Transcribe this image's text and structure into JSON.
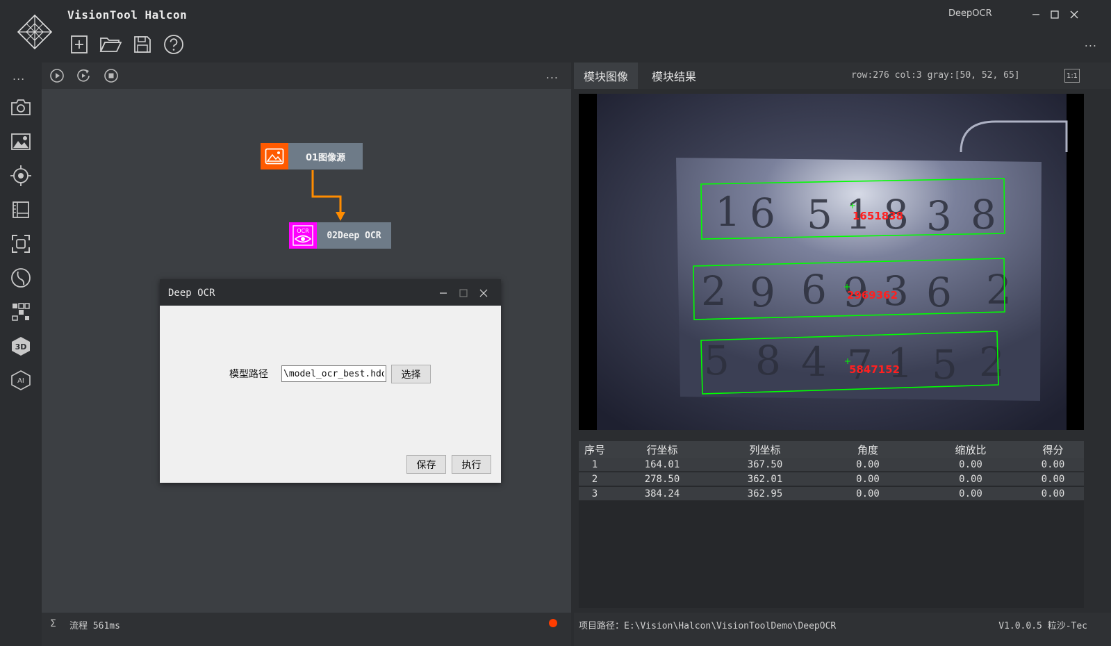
{
  "app": {
    "title": "VisionTool Halcon",
    "window_title": "DeepOCR",
    "more": "..."
  },
  "toolbar": {
    "icons": [
      "new-file-icon",
      "open-folder-icon",
      "save-icon",
      "help-icon"
    ]
  },
  "sidebar": {
    "more": "...",
    "icons": [
      "camera-icon",
      "image-adjust-icon",
      "target-icon",
      "ruler-icon",
      "focus-frame-icon",
      "curve-icon",
      "matrix-icon",
      "3d-icon",
      "ai-icon"
    ]
  },
  "flow": {
    "more": "...",
    "nodes": [
      {
        "label": "01图像源",
        "color": "#ff5a00"
      },
      {
        "label": "02Deep OCR",
        "color": "#ff00ff"
      }
    ],
    "sigma": "Σ",
    "status_text": "流程 561ms",
    "status_color": "#ff3d00"
  },
  "dialog": {
    "title": "Deep OCR",
    "model_path_label": "模型路径",
    "model_path_value": "\\model_ocr_best.hdo",
    "select_button": "选择",
    "save_button": "保存",
    "run_button": "执行"
  },
  "right": {
    "tabs": [
      "模块图像",
      "模块结果"
    ],
    "pixel_info": "row:276 col:3 gray:[50,  52,  65]",
    "ratio": "1:1",
    "ocr_labels": [
      "1651838",
      "2969362",
      "5847152"
    ],
    "accent_color": "#00ff00",
    "label_color": "#ff2020"
  },
  "table": {
    "headers": [
      "序号",
      "行坐标",
      "列坐标",
      "角度",
      "缩放比",
      "得分"
    ],
    "rows": [
      [
        "1",
        "164.01",
        "367.50",
        "0.00",
        "0.00",
        "0.00"
      ],
      [
        "2",
        "278.50",
        "362.01",
        "0.00",
        "0.00",
        "0.00"
      ],
      [
        "3",
        "384.24",
        "362.95",
        "0.00",
        "0.00",
        "0.00"
      ]
    ]
  },
  "status": {
    "project_path": "项目路径：E:\\Vision\\Halcon\\VisionToolDemo\\DeepOCR",
    "version": "V1.0.0.5 粒沙-Tec"
  }
}
